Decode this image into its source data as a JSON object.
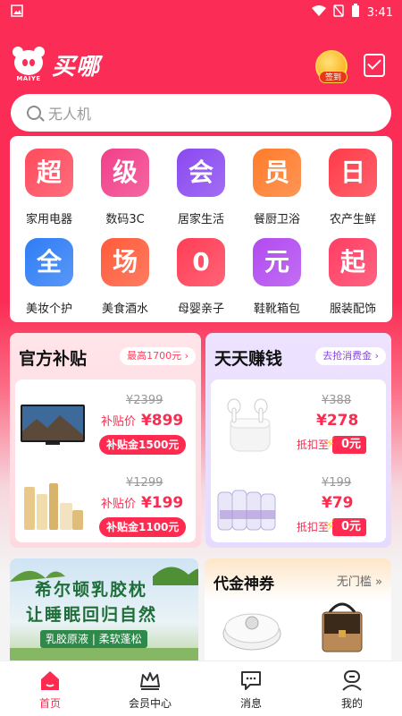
{
  "status": {
    "time": "3:41"
  },
  "header": {
    "app_name": "买哪",
    "logo_sub": "MAIYE",
    "signin_label": "签到"
  },
  "search": {
    "placeholder": "无人机"
  },
  "categories": [
    {
      "glyph": "超",
      "label": "家用电器",
      "color": "#ff4a5c"
    },
    {
      "glyph": "级",
      "label": "数码3C",
      "color": "#f23f8a"
    },
    {
      "glyph": "会",
      "label": "居家生活",
      "color": "#8a49f0"
    },
    {
      "glyph": "员",
      "label": "餐厨卫浴",
      "color": "#ff7b2a"
    },
    {
      "glyph": "日",
      "label": "农产生鲜",
      "color": "#ff3b48"
    },
    {
      "glyph": "全",
      "label": "美妆个护",
      "color": "#2f7df5"
    },
    {
      "glyph": "场",
      "label": "美食酒水",
      "color": "#ff5b3a"
    },
    {
      "glyph": "0",
      "label": "母婴亲子",
      "color": "#ff3d55"
    },
    {
      "glyph": "元",
      "label": "鞋靴箱包",
      "color": "#b24af0"
    },
    {
      "glyph": "起",
      "label": "服装配饰",
      "color": "#ff3d63"
    }
  ],
  "subsidy": {
    "title": "官方补贴",
    "tag": "最高1700元",
    "items": [
      {
        "old_price": "¥2399",
        "price_label": "补贴价",
        "price": "¥899",
        "pill": "补贴金1500元"
      },
      {
        "old_price": "¥1299",
        "price_label": "补贴价",
        "price": "¥199",
        "pill": "补贴金1100元"
      }
    ]
  },
  "earn": {
    "title": "天天赚钱",
    "tag": "去抢消费金",
    "items": [
      {
        "old_price": "¥388",
        "price": "¥278",
        "deduct_label": "抵扣至",
        "deduct_value": "0元"
      },
      {
        "old_price": "¥199",
        "price": "¥79",
        "deduct_label": "抵扣至",
        "deduct_value": "0元"
      }
    ]
  },
  "banner": {
    "line1": "希尔顿乳胶枕",
    "line2": "让睡眠回归自然",
    "ribbon": "乳胶原液 | 柔软蓬松"
  },
  "voucher": {
    "title": "代金神券",
    "subtitle": "无门槛 »"
  },
  "tabs": [
    {
      "label": "首页",
      "active": true
    },
    {
      "label": "会员中心",
      "active": false
    },
    {
      "label": "消息",
      "active": false
    },
    {
      "label": "我的",
      "active": false
    }
  ]
}
